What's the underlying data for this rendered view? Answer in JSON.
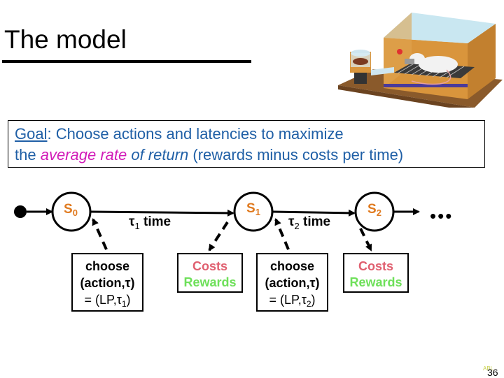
{
  "slide": {
    "title": "The model",
    "image": {
      "icon": "operant-chamber-rat-illustration"
    },
    "goal": {
      "label": "Goal",
      "colon": ":",
      "line1_rest": " Choose actions and latencies to maximize",
      "line2_pre": "the ",
      "line2_emph_pink": "average rate",
      "line2_emph_italic": " of return",
      "line2_post": " (rewards minus costs per time)"
    },
    "colors": {
      "goal_text": "#1f5fa6",
      "emphasis": "#d21cb8",
      "state_label": "#e07a1f",
      "costs": "#e06070",
      "rewards": "#6ee05a"
    },
    "states": [
      {
        "base": "S",
        "sub": "0"
      },
      {
        "base": "S",
        "sub": "1"
      },
      {
        "base": "S",
        "sub": "2"
      }
    ],
    "transitions": [
      {
        "tau": "τ",
        "sub": "1",
        "suffix": " time"
      },
      {
        "tau": "τ",
        "sub": "2",
        "suffix": " time"
      }
    ],
    "choose_boxes": [
      {
        "line1": "choose",
        "line2": "(action,τ)",
        "line3_pre": "= (LP,τ",
        "line3_sub": "1",
        "line3_post": ")"
      },
      {
        "line1": "choose",
        "line2": "(action,τ)",
        "line3_pre": "= (LP,τ",
        "line3_sub": "2",
        "line3_post": ")"
      }
    ],
    "outcome_boxes": [
      {
        "costs": "Costs",
        "rewards": "Rewards"
      },
      {
        "costs": "Costs",
        "rewards": "Rewards"
      }
    ],
    "continuation": "•••",
    "footer": {
      "tag": "ABL",
      "page": "36"
    }
  }
}
